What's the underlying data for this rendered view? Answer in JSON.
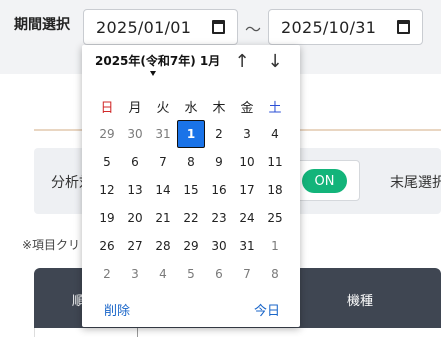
{
  "filter": {
    "period_label": "期間選択",
    "date_from": "2025/01/01",
    "date_to": "2025/10/31",
    "separator": "～"
  },
  "analysis": {
    "label": "分析対",
    "toggle_state": "ON",
    "tail_label": "末尾選択"
  },
  "note": "※項目クリ                                    示)",
  "table": {
    "headers": [
      "順",
      "機種"
    ]
  },
  "calendar": {
    "month_label": "2025年(令和7年) 1月",
    "weekdays": [
      "日",
      "月",
      "火",
      "水",
      "木",
      "金",
      "土"
    ],
    "weeks": [
      [
        {
          "d": "29",
          "o": true
        },
        {
          "d": "30",
          "o": true
        },
        {
          "d": "31",
          "o": true
        },
        {
          "d": "1",
          "s": true
        },
        {
          "d": "2"
        },
        {
          "d": "3"
        },
        {
          "d": "4"
        }
      ],
      [
        {
          "d": "5"
        },
        {
          "d": "6"
        },
        {
          "d": "7"
        },
        {
          "d": "8"
        },
        {
          "d": "9"
        },
        {
          "d": "10"
        },
        {
          "d": "11"
        }
      ],
      [
        {
          "d": "12"
        },
        {
          "d": "13"
        },
        {
          "d": "14"
        },
        {
          "d": "15"
        },
        {
          "d": "16"
        },
        {
          "d": "17"
        },
        {
          "d": "18"
        }
      ],
      [
        {
          "d": "19"
        },
        {
          "d": "20"
        },
        {
          "d": "21"
        },
        {
          "d": "22"
        },
        {
          "d": "23"
        },
        {
          "d": "24"
        },
        {
          "d": "25"
        }
      ],
      [
        {
          "d": "26"
        },
        {
          "d": "27"
        },
        {
          "d": "28"
        },
        {
          "d": "29"
        },
        {
          "d": "30"
        },
        {
          "d": "31"
        },
        {
          "d": "1",
          "o": true
        }
      ],
      [
        {
          "d": "2",
          "o": true
        },
        {
          "d": "3",
          "o": true
        },
        {
          "d": "4",
          "o": true
        },
        {
          "d": "5",
          "o": true
        },
        {
          "d": "6",
          "o": true
        },
        {
          "d": "7",
          "o": true
        },
        {
          "d": "8",
          "o": true
        }
      ]
    ],
    "clear_label": "削除",
    "today_label": "今日"
  },
  "colors": {
    "accent": "#1a73e8",
    "toggle_on": "#13b47a",
    "sunday": "#d12a2a",
    "saturday": "#2b4fd6",
    "table_header": "#3f4652"
  },
  "icons": {
    "calendar": "calendar-icon",
    "prev": "arrow-up-icon",
    "next": "arrow-down-icon"
  }
}
